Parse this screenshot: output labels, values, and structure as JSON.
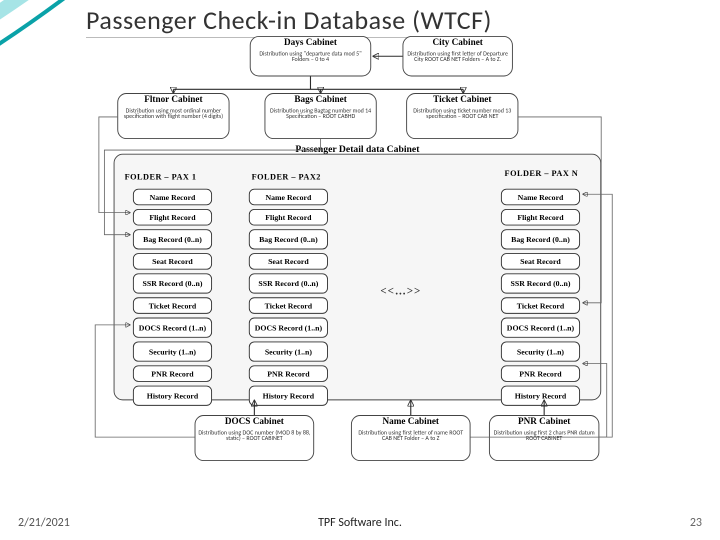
{
  "title": "Passenger Check-in Database (WTCF)",
  "footer": {
    "date": "2/21/2021",
    "org": "TPF Software Inc.",
    "page": "23"
  },
  "top": {
    "days": {
      "title": "Days Cabinet",
      "desc": "Distribution using\n\"departure data mod 5\"\nFolders – 0 to 4"
    },
    "city": {
      "title": "City Cabinet",
      "desc": "Distribution using first\nletter of Departure City\nROOT CAB NET\nFolders – A to Z."
    }
  },
  "mid": {
    "fltnor": {
      "title": "Fltnor Cabinet",
      "desc": "Distribution using\nmost ordinal number\nspecification with flight\nnumber (4 digits)"
    },
    "bags": {
      "title": "Bags Cabinet",
      "desc": "Distribution using\nBagtag number mod 14\nSpecification –\nROOT CABHD"
    },
    "ticket": {
      "title": "Ticket Cabinet",
      "desc": "Distribution using\nticket number mod 13\nspecification –\nROOT CAB NET"
    }
  },
  "pdd": {
    "title": "Passenger Detail data\nCabinet",
    "f1": "FOLDER – PAX 1",
    "f2": "FOLDER – PAX2",
    "fn": "FOLDER – PAX\nN",
    "dots": "<<…>>"
  },
  "records": [
    "Name Record",
    "Flight Record",
    "Bag Record\n(0..n)",
    "Seat Record",
    "SSR Record\n(0..n)",
    "Ticket Record",
    "DOCS Record\n(1..n)",
    "Security\n(1..n)",
    "PNR Record",
    "History\nRecord"
  ],
  "bottom": {
    "docs": {
      "title": "DOCS Cabinet",
      "desc": "Distribution using DOC\nnumber (MOD 8 by 88,\nstatic) –\nROOT CABINET"
    },
    "name": {
      "title": "Name Cabinet",
      "desc": "Distribution using first\nletter of name\nROOT CAB NET\nFolder – A to Z"
    },
    "pnr": {
      "title": "PNR Cabinet",
      "desc": "Distribution using\nfirst 2 chars PNR datum\nROOT CABINET"
    }
  },
  "chart_data": {
    "type": "diagram",
    "title": "Passenger Check-in Database (WTCF)",
    "nodes": [
      {
        "id": "days",
        "label": "Days Cabinet",
        "detail": "Distribution using \"departure data mod 5\" – Folders 0 to 4"
      },
      {
        "id": "city",
        "label": "City Cabinet",
        "detail": "Distribution using first letter of Departure City – ROOT CAB NET – Folders A to Z"
      },
      {
        "id": "fltnor",
        "label": "Fltnor Cabinet",
        "detail": "Distribution using most-ordinal-number specification with flight number (4 digits)"
      },
      {
        "id": "bags",
        "label": "Bags Cabinet",
        "detail": "Distribution using Bagtag number mod 14 – ROOT CABHD"
      },
      {
        "id": "ticket",
        "label": "Ticket Cabinet",
        "detail": "Distribution using ticket number mod 13 – ROOT CAB NET"
      },
      {
        "id": "pdd",
        "label": "Passenger Detail data Cabinet",
        "folders": [
          "PAX 1",
          "PAX2",
          "…",
          "PAX N"
        ],
        "records": [
          "Name Record",
          "Flight Record",
          "Bag Record (0..n)",
          "Seat Record",
          "SSR Record (0..n)",
          "Ticket Record",
          "DOCS Record (1..n)",
          "Security (1..n)",
          "PNR Record",
          "History Record"
        ]
      },
      {
        "id": "docs",
        "label": "DOCS Cabinet",
        "detail": "Distribution using DOC number (MOD 8 by 88, static) – ROOT CABINET"
      },
      {
        "id": "name",
        "label": "Name Cabinet",
        "detail": "Distribution using first letter of name – ROOT CAB NET – Folder A to Z"
      },
      {
        "id": "pnr",
        "label": "PNR Cabinet",
        "detail": "Distribution using first 2 chars of PNR datum – ROOT CABINET"
      }
    ],
    "edges": [
      {
        "from": "city",
        "to": "days"
      },
      {
        "from": "days",
        "to": "fltnor"
      },
      {
        "from": "days",
        "to": "bags"
      },
      {
        "from": "days",
        "to": "ticket"
      },
      {
        "from": "fltnor",
        "to": "pdd.FlightRecord"
      },
      {
        "from": "bags",
        "to": "pdd.BagRecord"
      },
      {
        "from": "ticket",
        "to": "pdd.TicketRecord"
      },
      {
        "from": "docs",
        "to": "pdd.DOCSRecord"
      },
      {
        "from": "name",
        "to": "pdd.NameRecord"
      },
      {
        "from": "pnr",
        "to": "pdd.PNRRecord"
      }
    ]
  }
}
